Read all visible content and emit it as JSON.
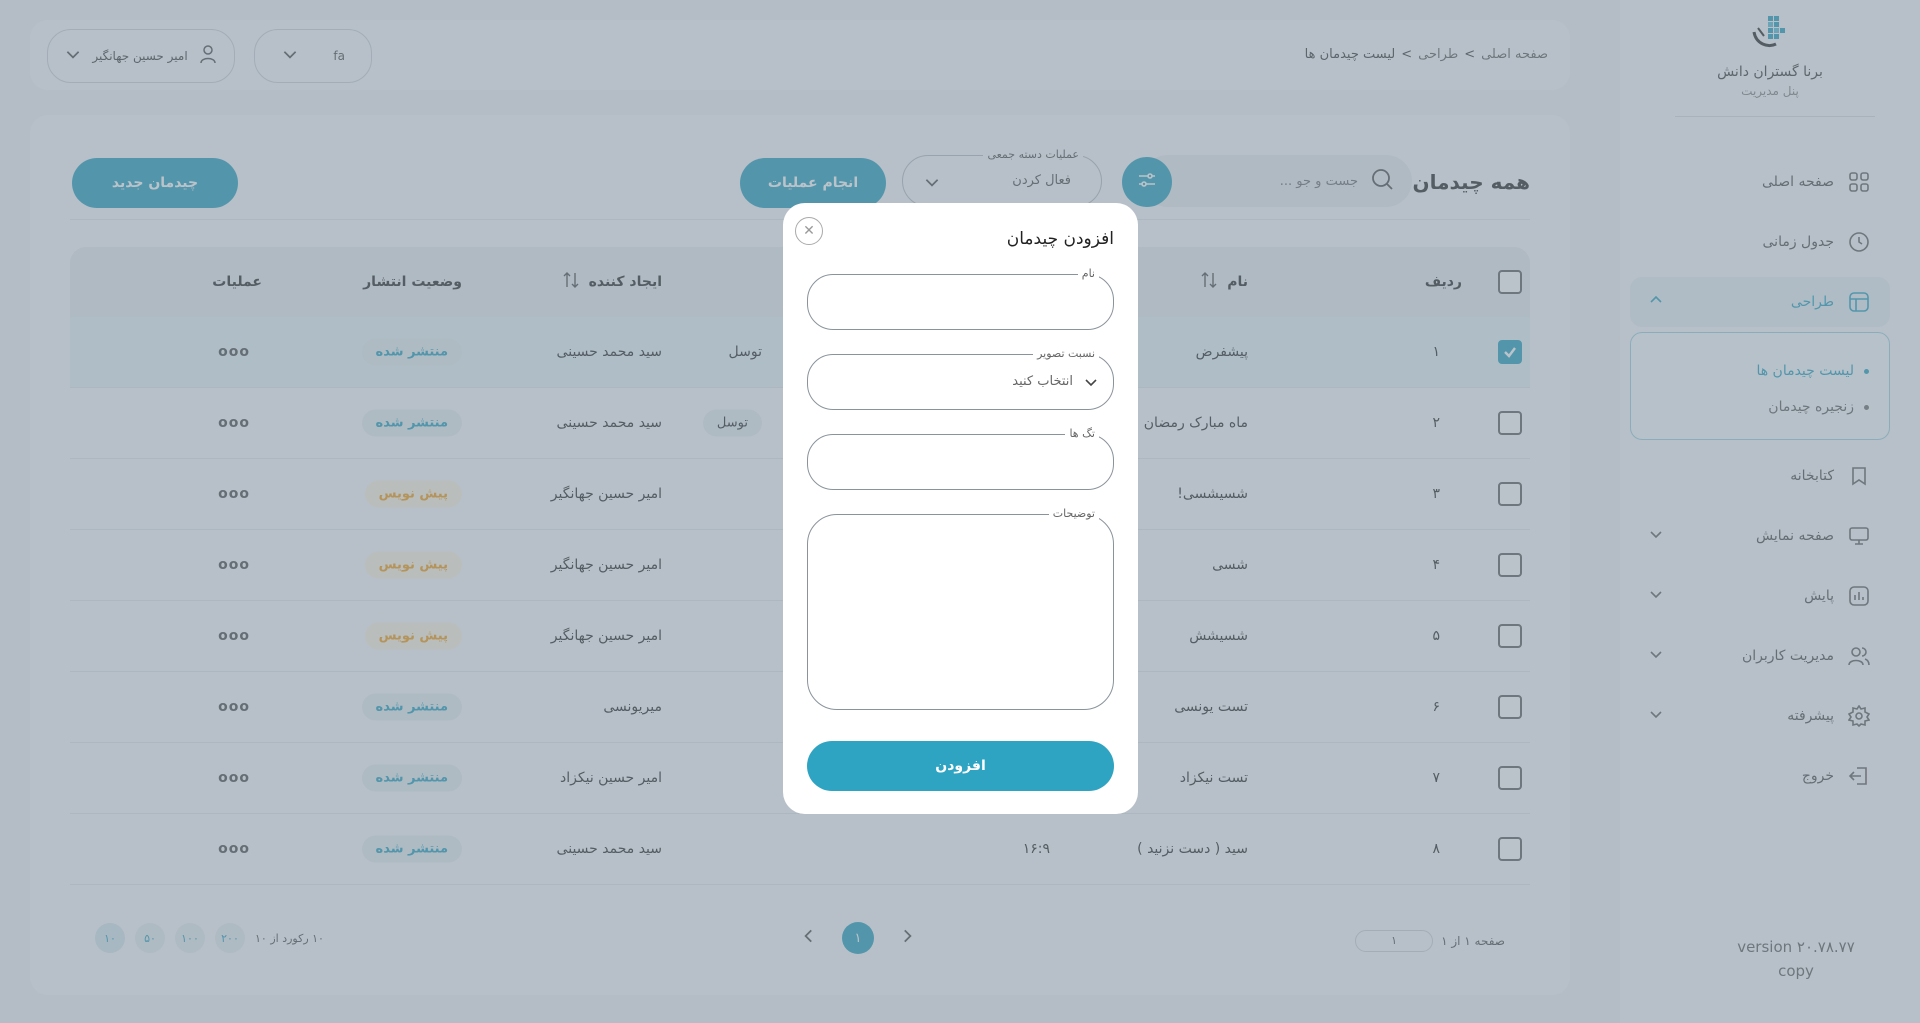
{
  "brand": {
    "name": "برنا گستران دانش",
    "subtitle": "پنل مدیریت"
  },
  "sidebar": {
    "items": [
      {
        "label": "صفحه اصلی",
        "icon": "grid-icon"
      },
      {
        "label": "جدول زمانی",
        "icon": "clock-icon"
      },
      {
        "label": "طراحی",
        "icon": "layout-icon",
        "expanded": true
      },
      {
        "label": "کتابخانه",
        "icon": "bookmark-icon"
      },
      {
        "label": "صفحه نمایش",
        "icon": "monitor-icon"
      },
      {
        "label": "پایش",
        "icon": "chart-icon"
      },
      {
        "label": "مدیریت کاربران",
        "icon": "users-icon"
      },
      {
        "label": "پیشرفته",
        "icon": "gear-icon"
      },
      {
        "label": "خروج",
        "icon": "logout-icon"
      }
    ],
    "submenu": [
      {
        "label": "لیست چیدمان ها",
        "active": true
      },
      {
        "label": "زنجیره چیدمان",
        "active": false
      }
    ],
    "version": "version ۲۰.۷۸.۷۷",
    "version_sub": "copy"
  },
  "header": {
    "breadcrumb": [
      "صفحه اصلی",
      "طراحی",
      "لیست چیدمان ها"
    ],
    "user_name": "امیر حسین جهانگیر",
    "lang": "fa"
  },
  "toolbar": {
    "title": "همه چیدمان",
    "search_placeholder": "جست و جو ...",
    "bulk_legend": "عملیات دسته جمعی",
    "bulk_value": "فعال کردن",
    "do_label": "انجام عملیات",
    "new_label": "چیدمان جدید"
  },
  "table": {
    "headers": {
      "row": "ردیف",
      "name": "نام",
      "creator": "ایجاد کننده",
      "status": "وضعیت انتشار",
      "actions": "عملیات"
    },
    "rows": [
      {
        "num": "۱",
        "name": "پیشفرض",
        "extra": "توسل",
        "creator": "سید محمد حسینی",
        "status": "منتشر شده",
        "kind": "pub",
        "checked": true
      },
      {
        "num": "۲",
        "name": "ماه مبارک رمضان",
        "extra": "توسل",
        "creator": "سید محمد حسینی",
        "status": "منتشر شده",
        "kind": "pub",
        "checked": false
      },
      {
        "num": "۳",
        "name": "شسیشسی!",
        "extra": "",
        "creator": "امیر حسین جهانگیر",
        "status": "پیش نویس",
        "kind": "draft",
        "checked": false
      },
      {
        "num": "۴",
        "name": "شسی",
        "extra": "",
        "creator": "امیر حسین جهانگیر",
        "status": "پیش نویس",
        "kind": "draft",
        "checked": false
      },
      {
        "num": "۵",
        "name": "شسیشش",
        "extra": "",
        "creator": "امیر حسین جهانگیر",
        "status": "پیش نویس",
        "kind": "draft",
        "checked": false
      },
      {
        "num": "۶",
        "name": "تست یونسی",
        "extra": "",
        "creator": "میریونسی",
        "status": "منتشر شده",
        "kind": "pub",
        "checked": false
      },
      {
        "num": "۷",
        "name": "تست نیکزاد",
        "extra": "",
        "creator": "امیر حسین نیکزاد",
        "status": "منتشر شده",
        "kind": "pub",
        "checked": false
      },
      {
        "num": "۸",
        "name": "سید ( دست نزنید )",
        "extra": "۱۶:۹",
        "creator": "سید محمد حسینی",
        "status": "منتشر شده",
        "kind": "pub",
        "checked": false
      }
    ],
    "actions_glyph": "ooo"
  },
  "pager": {
    "page_label": "صفحه ۱ از ۱",
    "page_input": "۱",
    "current": "۱",
    "records": "۱۰ رکورد از ۱۰",
    "sizes": [
      "۱۰",
      "۵۰",
      "۱۰۰",
      "۲۰۰"
    ]
  },
  "modal": {
    "title": "افزودن چیدمان",
    "name_legend": "نام",
    "ratio_legend": "نسبت تصویر",
    "ratio_value": "انتخاب کنید",
    "tags_legend": "تگ ها",
    "desc_legend": "توضیحات",
    "submit": "افزودن"
  },
  "colors": {
    "accent": "#2fa4c2",
    "draft": "#f0a020"
  }
}
